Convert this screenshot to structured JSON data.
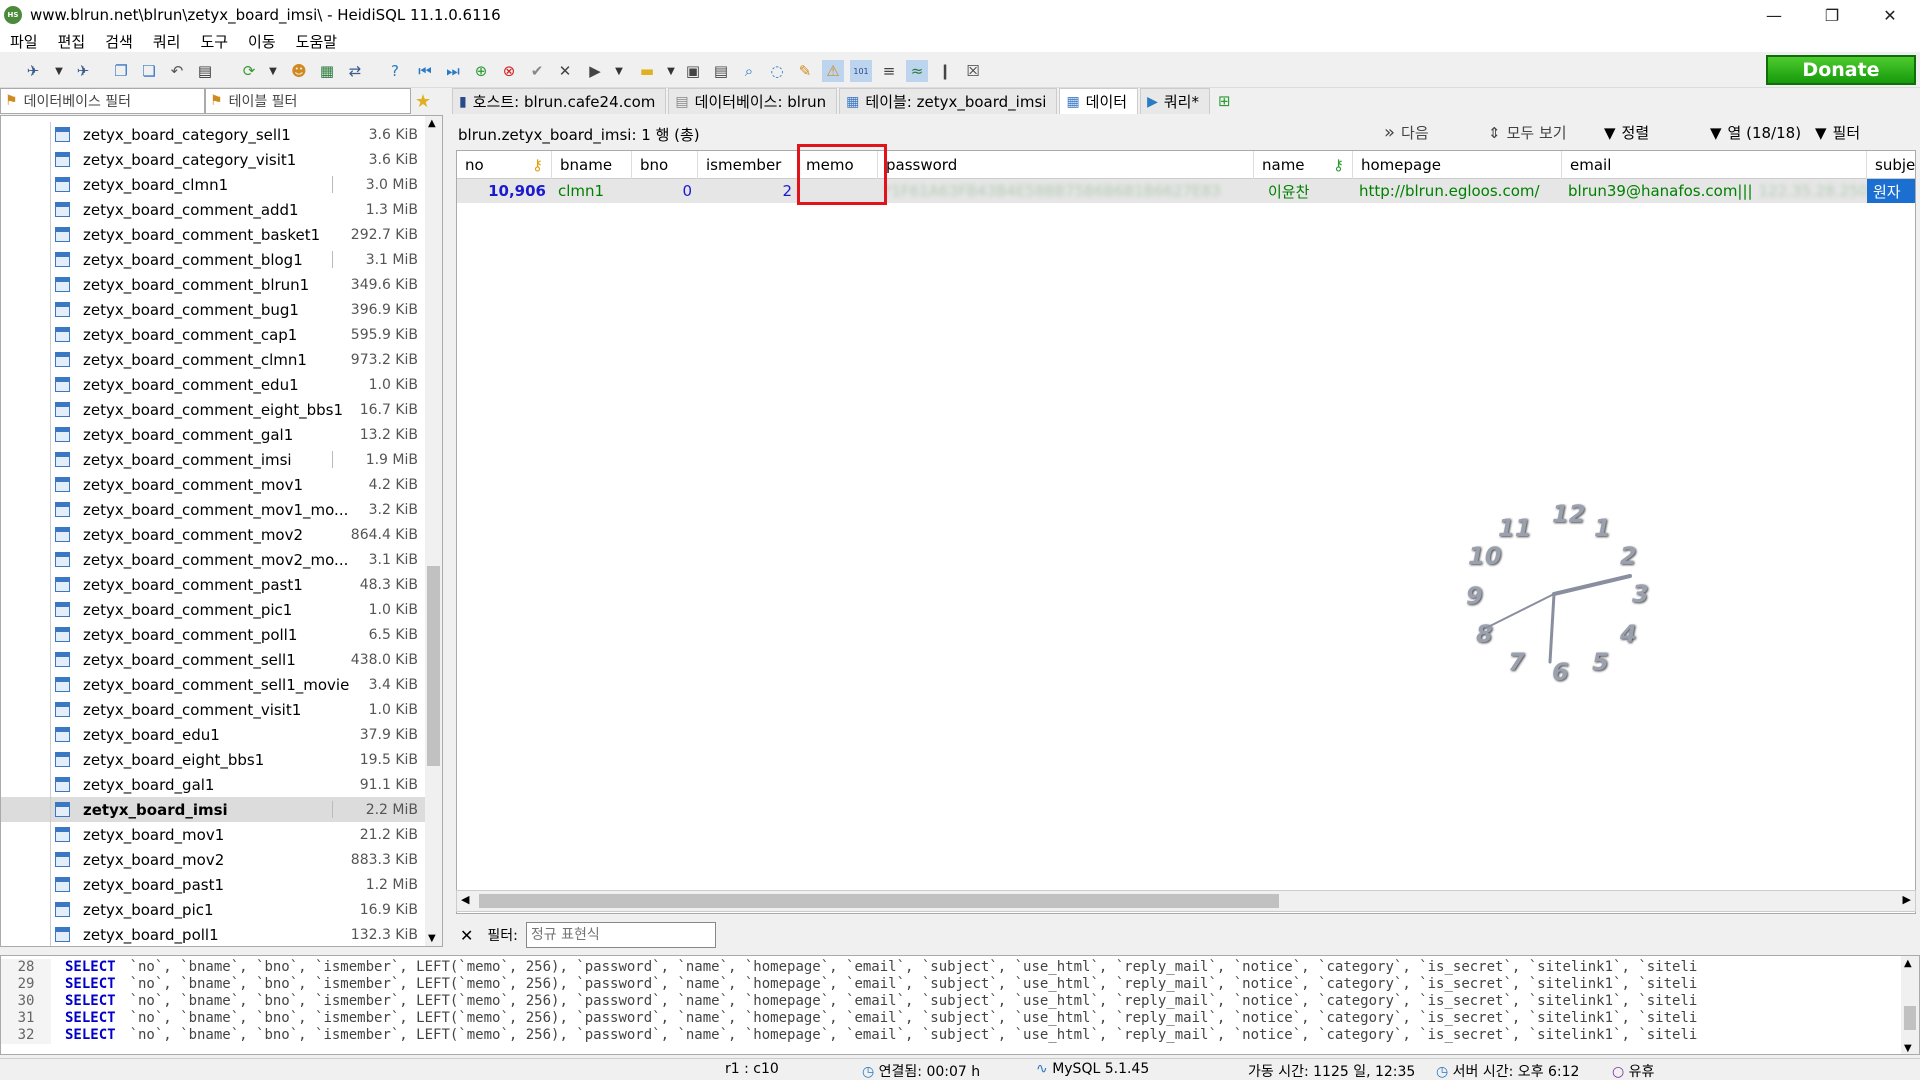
{
  "window": {
    "title": "www.blrun.net\\blrun\\zetyx_board_imsi\\ - HeidiSQL 11.1.0.6116",
    "app_icon": "HS",
    "minimize": "—",
    "restore": "❐",
    "close": "✕"
  },
  "menu": [
    "파일",
    "편집",
    "검색",
    "쿼리",
    "도구",
    "이동",
    "도움말"
  ],
  "toolbar": {
    "donate_label": "Donate"
  },
  "left_filters": {
    "database_filter": "데이터베이스 필터",
    "table_filter": "테이블 필터"
  },
  "tabs": [
    {
      "label": "호스트: blrun.cafe24.com",
      "icon": "host-icon"
    },
    {
      "label": "데이터베이스: blrun",
      "icon": "database-icon"
    },
    {
      "label": "테이블: zetyx_board_imsi",
      "icon": "table-icon"
    },
    {
      "label": "데이터",
      "icon": "grid-icon"
    },
    {
      "label": "쿼리*",
      "icon": "play-icon"
    }
  ],
  "tree": {
    "items": [
      {
        "name": "zetyx_board_category_sell1",
        "size": "3.6 KiB"
      },
      {
        "name": "zetyx_board_category_visit1",
        "size": "3.6 KiB"
      },
      {
        "name": "zetyx_board_clmn1",
        "size": "3.0 MiB"
      },
      {
        "name": "zetyx_board_comment_add1",
        "size": "1.3 MiB"
      },
      {
        "name": "zetyx_board_comment_basket1",
        "size": "292.7 KiB"
      },
      {
        "name": "zetyx_board_comment_blog1",
        "size": "3.1 MiB"
      },
      {
        "name": "zetyx_board_comment_blrun1",
        "size": "349.6 KiB"
      },
      {
        "name": "zetyx_board_comment_bug1",
        "size": "396.9 KiB"
      },
      {
        "name": "zetyx_board_comment_cap1",
        "size": "595.9 KiB"
      },
      {
        "name": "zetyx_board_comment_clmn1",
        "size": "973.2 KiB"
      },
      {
        "name": "zetyx_board_comment_edu1",
        "size": "1.0 KiB"
      },
      {
        "name": "zetyx_board_comment_eight_bbs1",
        "size": "16.7 KiB"
      },
      {
        "name": "zetyx_board_comment_gal1",
        "size": "13.2 KiB"
      },
      {
        "name": "zetyx_board_comment_imsi",
        "size": "1.9 MiB"
      },
      {
        "name": "zetyx_board_comment_mov1",
        "size": "4.2 KiB"
      },
      {
        "name": "zetyx_board_comment_mov1_mo...",
        "size": "3.2 KiB"
      },
      {
        "name": "zetyx_board_comment_mov2",
        "size": "864.4 KiB"
      },
      {
        "name": "zetyx_board_comment_mov2_mo...",
        "size": "3.1 KiB"
      },
      {
        "name": "zetyx_board_comment_past1",
        "size": "48.3 KiB"
      },
      {
        "name": "zetyx_board_comment_pic1",
        "size": "1.0 KiB"
      },
      {
        "name": "zetyx_board_comment_poll1",
        "size": "6.5 KiB"
      },
      {
        "name": "zetyx_board_comment_sell1",
        "size": "438.0 KiB"
      },
      {
        "name": "zetyx_board_comment_sell1_movie",
        "size": "3.4 KiB"
      },
      {
        "name": "zetyx_board_comment_visit1",
        "size": "1.0 KiB"
      },
      {
        "name": "zetyx_board_edu1",
        "size": "37.9 KiB"
      },
      {
        "name": "zetyx_board_eight_bbs1",
        "size": "19.5 KiB"
      },
      {
        "name": "zetyx_board_gal1",
        "size": "91.1 KiB"
      },
      {
        "name": "zetyx_board_imsi",
        "size": "2.2 MiB",
        "selected": true
      },
      {
        "name": "zetyx_board_mov1",
        "size": "21.2 KiB"
      },
      {
        "name": "zetyx_board_mov2",
        "size": "883.3 KiB"
      },
      {
        "name": "zetyx_board_past1",
        "size": "1.2 MiB"
      },
      {
        "name": "zetyx_board_pic1",
        "size": "16.9 KiB"
      },
      {
        "name": "zetyx_board_poll1",
        "size": "132.3 KiB"
      }
    ]
  },
  "data_view": {
    "breadcrumb": "blrun.zetyx_board_imsi: 1 행 (총)",
    "next_label": "다음",
    "show_all_label": "모두 보기",
    "sort_label": "정렬",
    "columns_label": "열 (18/18)",
    "filter_label": "필터",
    "columns": [
      "no",
      "bname",
      "bno",
      "ismember",
      "memo",
      "password",
      "name",
      "homepage",
      "email",
      "subjec"
    ],
    "row": {
      "no": "10,906",
      "bname": "clmn1",
      "bno": "0",
      "ismember": "2",
      "memo": "",
      "password": "*1F61A63FB43B4E58BB75B6B6B1B6627E83",
      "name": "이윤찬",
      "homepage": "http://blrun.egloos.com/",
      "email": "blrun39@hanafos.com|||",
      "email_extra": "122.35.28.250",
      "subject": "원자"
    }
  },
  "clock": {
    "numerals": [
      "12",
      "1",
      "2",
      "3",
      "4",
      "5",
      "6",
      "7",
      "8",
      "9",
      "10",
      "11"
    ]
  },
  "filter_bar": {
    "label": "필터:",
    "placeholder": "정규 표현식"
  },
  "sql_log": [
    {
      "line": "28",
      "keyword": "SELECT",
      "text": "`no`, `bname`, `bno`, `ismember`, LEFT(`memo`, 256), `password`, `name`, `homepage`, `email`, `subject`, `use_html`, `reply_mail`, `notice`, `category`, `is_secret`, `sitelink1`, `siteli"
    },
    {
      "line": "29",
      "keyword": "SELECT",
      "text": "`no`, `bname`, `bno`, `ismember`, LEFT(`memo`, 256), `password`, `name`, `homepage`, `email`, `subject`, `use_html`, `reply_mail`, `notice`, `category`, `is_secret`, `sitelink1`, `siteli"
    },
    {
      "line": "30",
      "keyword": "SELECT",
      "text": "`no`, `bname`, `bno`, `ismember`, LEFT(`memo`, 256), `password`, `name`, `homepage`, `email`, `subject`, `use_html`, `reply_mail`, `notice`, `category`, `is_secret`, `sitelink1`, `siteli"
    },
    {
      "line": "31",
      "keyword": "SELECT",
      "text": "`no`, `bname`, `bno`, `ismember`, LEFT(`memo`, 256), `password`, `name`, `homepage`, `email`, `subject`, `use_html`, `reply_mail`, `notice`, `category`, `is_secret`, `sitelink1`, `siteli"
    },
    {
      "line": "32",
      "keyword": "SELECT",
      "text": "`no`, `bname`, `bno`, `ismember`, LEFT(`memo`, 256), `password`, `name`, `homepage`, `email`, `subject`, `use_html`, `reply_mail`, `notice`, `category`, `is_secret`, `sitelink1`, `siteli"
    }
  ],
  "status": {
    "cursor": "r1 : c10",
    "connected": "연결됨: 00:07 h",
    "server_version": "MySQL 5.1.45",
    "uptime": "가동 시간: 1125 일, 12:35",
    "server_time": "서버 시간: 오후 6:12",
    "idle": "유휴"
  },
  "colors": {
    "accent": "#3a78c4",
    "highlight": "#e0141a",
    "donate": "#169a0c",
    "number": "#1a1ad0",
    "text_value": "#008000"
  }
}
